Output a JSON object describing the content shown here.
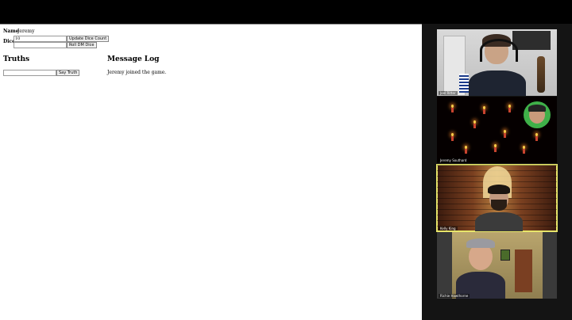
{
  "form": {
    "name_label": "Name",
    "name_value": "Jeremy",
    "dice_label": "Dice",
    "dice_value": "10",
    "update_dice_button": "Update Dice Count",
    "roll_dm_dice_button": "Roll DM Dice"
  },
  "truths": {
    "heading": "Truths",
    "input_value": "",
    "say_truth_button": "Say Truth"
  },
  "message_log": {
    "heading": "Message Log",
    "messages": [
      "Jeremy joined the game."
    ]
  },
  "participants": [
    {
      "name": "Joel Ritter"
    },
    {
      "name": "Jeremy Southard"
    },
    {
      "name": "Kelly King",
      "active_speaker": true
    },
    {
      "name": "Richie Hawthorne"
    }
  ],
  "colors": {
    "active_speaker_outline": "#e8e66a",
    "gallery_background": "#141414"
  }
}
